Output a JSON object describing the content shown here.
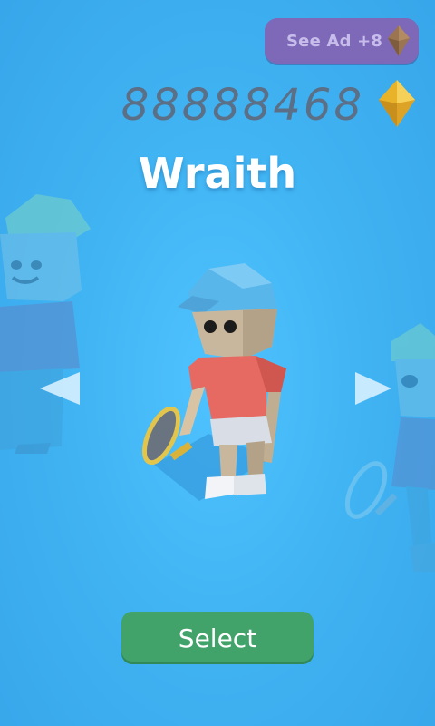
{
  "hud": {
    "ad_button_label": "See Ad +8",
    "coin_count": "88888468",
    "currency_icon": "diamond-icon",
    "gem_color": "#e9b329",
    "ad_gem_color": "#9b7552"
  },
  "character": {
    "name": "Wraith"
  },
  "nav": {
    "prev_icon": "triangle-left-icon",
    "next_icon": "triangle-right-icon"
  },
  "actions": {
    "select_label": "Select",
    "select_color": "#41a36a"
  }
}
